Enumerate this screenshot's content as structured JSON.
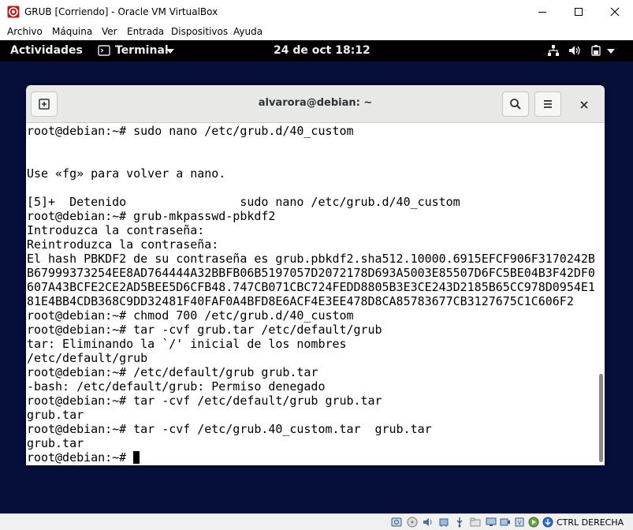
{
  "window": {
    "title": "GRUB [Corriendo] - Oracle VM VirtualBox",
    "minimize_icon": "minimize-icon",
    "maximize_icon": "maximize-icon",
    "close_icon": "close-icon"
  },
  "menubar": {
    "items": [
      "Archivo",
      "Máquina",
      "Ver",
      "Entrada",
      "Dispositivos",
      "Ayuda"
    ]
  },
  "gnome": {
    "activities": "Actividades",
    "app_menu": "Terminal",
    "clock": "24 de oct  18:12",
    "tray_icons": [
      "network-icon",
      "volume-icon",
      "power-icon"
    ]
  },
  "terminal": {
    "title": "alvarora@debian: ~",
    "new_tab_icon": "new-tab-icon",
    "search_icon": "search-icon",
    "menu_icon": "hamburger-menu-icon",
    "close_icon": "close-icon",
    "lines": [
      "root@debian:~# sudo nano /etc/grub.d/40_custom",
      "",
      "",
      "Use «fg» para volver a nano.",
      "",
      "[5]+  Detenido                sudo nano /etc/grub.d/40_custom",
      "root@debian:~# grub-mkpasswd-pbkdf2",
      "Introduzca la contraseña:",
      "Reintroduzca la contraseña:",
      "El hash PBKDF2 de su contraseña es grub.pbkdf2.sha512.10000.6915EFCF906F3170242B",
      "B67999373254EE8AD764444A32BBFB06B5197057D2072178D693A5003E85507D6FC5BE04B3F42DF0",
      "607A43BCFE2CE2AD5BEE5D6CFB48.747CB071CBC724FEDD8805B3E3CE243D2185B65CC978D0954E1",
      "81E4BB4CDB368C9DD32481F40FAF0A4BFD8E6ACF4E3EE478D8CA85783677CB3127675C1C606F2",
      "root@debian:~# chmod 700 /etc/grub.d/40_custom",
      "root@debian:~# tar -cvf grub.tar /etc/default/grub",
      "tar: Eliminando la `/' inicial de los nombres",
      "/etc/default/grub",
      "root@debian:~# /etc/default/grub grub.tar",
      "-bash: /etc/default/grub: Permiso denegado",
      "root@debian:~# tar -cvf /etc/default/grub grub.tar",
      "grub.tar",
      "root@debian:~# tar -cvf /etc/grub.40_custom.tar  grub.tar",
      "grub.tar"
    ],
    "prompt": "root@debian:~# "
  },
  "statusbar": {
    "host_key": "CTRL DERECHA"
  }
}
